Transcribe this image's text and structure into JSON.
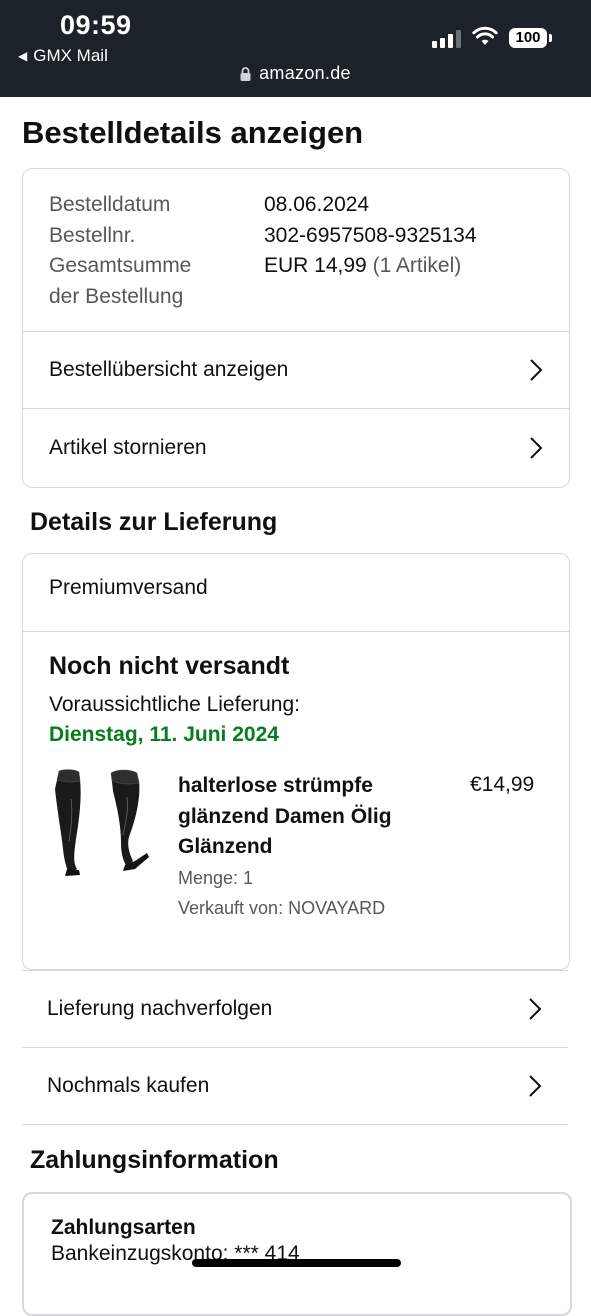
{
  "status_bar": {
    "time": "09:59",
    "back_app": "GMX Mail",
    "url": "amazon.de",
    "battery": "100"
  },
  "page": {
    "title": "Bestelldetails anzeigen"
  },
  "order_summary": {
    "rows": [
      {
        "label": "Bestelldatum",
        "value": "08.06.2024"
      },
      {
        "label": "Bestellnr.",
        "value": "302-6957508-9325134"
      }
    ],
    "total_label_line1": "Gesamtsumme",
    "total_label_line2": "der Bestellung",
    "total_value": "EUR 14,99",
    "total_items": "(1 Artikel)",
    "links": [
      {
        "label": "Bestellübersicht anzeigen"
      },
      {
        "label": "Artikel stornieren"
      }
    ]
  },
  "delivery": {
    "section_title": "Details zur Lieferung",
    "shipping_method": "Premiumversand",
    "status": "Noch nicht versandt",
    "estimate_label": "Voraussichtliche Lieferung:",
    "estimate_date": "Dienstag, 11. Juni 2024",
    "item": {
      "title_line1": "halterlose strümpfe",
      "title_line2": "glänzend Damen Ölig",
      "title_line3": "Glänzend",
      "price": "€14,99",
      "quantity": "Menge: 1",
      "seller": "Verkauft von: NOVAYARD"
    },
    "actions": [
      {
        "label": "Lieferung nachverfolgen"
      },
      {
        "label": "Nochmals kaufen"
      }
    ]
  },
  "payment": {
    "section_title": "Zahlungsinformation",
    "methods_title": "Zahlungsarten",
    "account_line": "Bankeinzugskonto: *** 414"
  },
  "colors": {
    "status_bar_bg": "#1b2229",
    "delivery_date_green": "#067d1f",
    "border": "#d5d9d9",
    "muted_text": "#565959"
  },
  "icons": [
    "back-arrow-icon",
    "lock-icon",
    "signal-icon",
    "wifi-icon",
    "battery-icon",
    "chevron-right-icon",
    "product-image"
  ]
}
